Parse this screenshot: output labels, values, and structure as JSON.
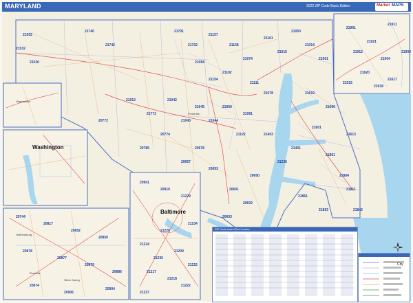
{
  "header": {
    "title": "MARYLAND",
    "edition": "2022 ZIP Code Basic Edition",
    "logo_word1": "Market",
    "logo_word2": "MAPS"
  },
  "insets": {
    "washington_label": "Washington",
    "baltimore_label": "Baltimore",
    "gaithersburg_label": "Gaithersburg",
    "rockville_label": "Rockville",
    "silver_spring_label": "Silver Spring",
    "hagerstown_label": "Hagerstown",
    "frederick_label": "Frederick"
  },
  "zip_labels": [
    "21502",
    "21532",
    "21520",
    "21740",
    "21742",
    "21701",
    "21702",
    "21157",
    "21158",
    "21074",
    "21102",
    "21111",
    "21161",
    "21154",
    "21084",
    "21050",
    "21014",
    "21015",
    "21001",
    "21078",
    "21901",
    "21921",
    "21904",
    "21620",
    "21617",
    "21619",
    "21666",
    "21601",
    "21613",
    "21801",
    "21804",
    "21811",
    "21842",
    "21853",
    "21851",
    "20601",
    "20602",
    "20603",
    "20650",
    "20653",
    "20678",
    "20657",
    "20785",
    "20774",
    "20772",
    "20744",
    "20817",
    "20852",
    "20850",
    "20878",
    "20877",
    "20879",
    "20886",
    "20874",
    "20906",
    "20904",
    "20901",
    "20910",
    "21229",
    "21224",
    "21230",
    "21209",
    "21215",
    "21217",
    "21218",
    "21222",
    "21227",
    "21228",
    "21234",
    "21236",
    "21401",
    "21403",
    "21122",
    "21061",
    "21060",
    "21044",
    "21045",
    "21043",
    "21042",
    "21771",
    "21913",
    "21911",
    "21903",
    "21918",
    "21912",
    "21915"
  ],
  "index": {
    "title": "ZIP Code Index/Grid Locator"
  },
  "legend": {
    "city_label": "City"
  },
  "colors": {
    "title_bar": "#3a68b8",
    "water": "#a9d6ef",
    "land": "#f7f4de",
    "zip_text": "#1b3fa6",
    "border_line": "#4a6dc4"
  }
}
